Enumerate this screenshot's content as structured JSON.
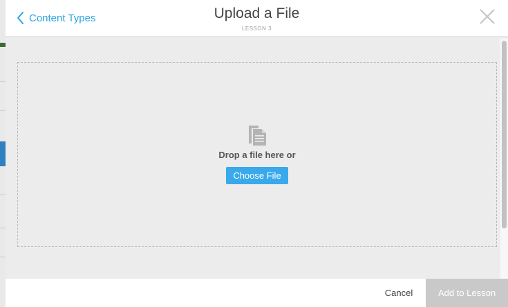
{
  "header": {
    "back_label": "Content Types",
    "title": "Upload a File",
    "subtitle": "LESSON 3"
  },
  "dropzone": {
    "prompt": "Drop a file here or",
    "choose_label": "Choose File"
  },
  "footer": {
    "cancel_label": "Cancel",
    "add_label": "Add to Lesson"
  },
  "icons": {
    "back": "chevron-left-icon",
    "close": "close-icon",
    "file": "file-document-icon"
  },
  "colors": {
    "accent": "#2aa3e3",
    "button": "#39a9ec",
    "disabled": "#c9c9c9",
    "dropzone_bg": "#ececec"
  }
}
